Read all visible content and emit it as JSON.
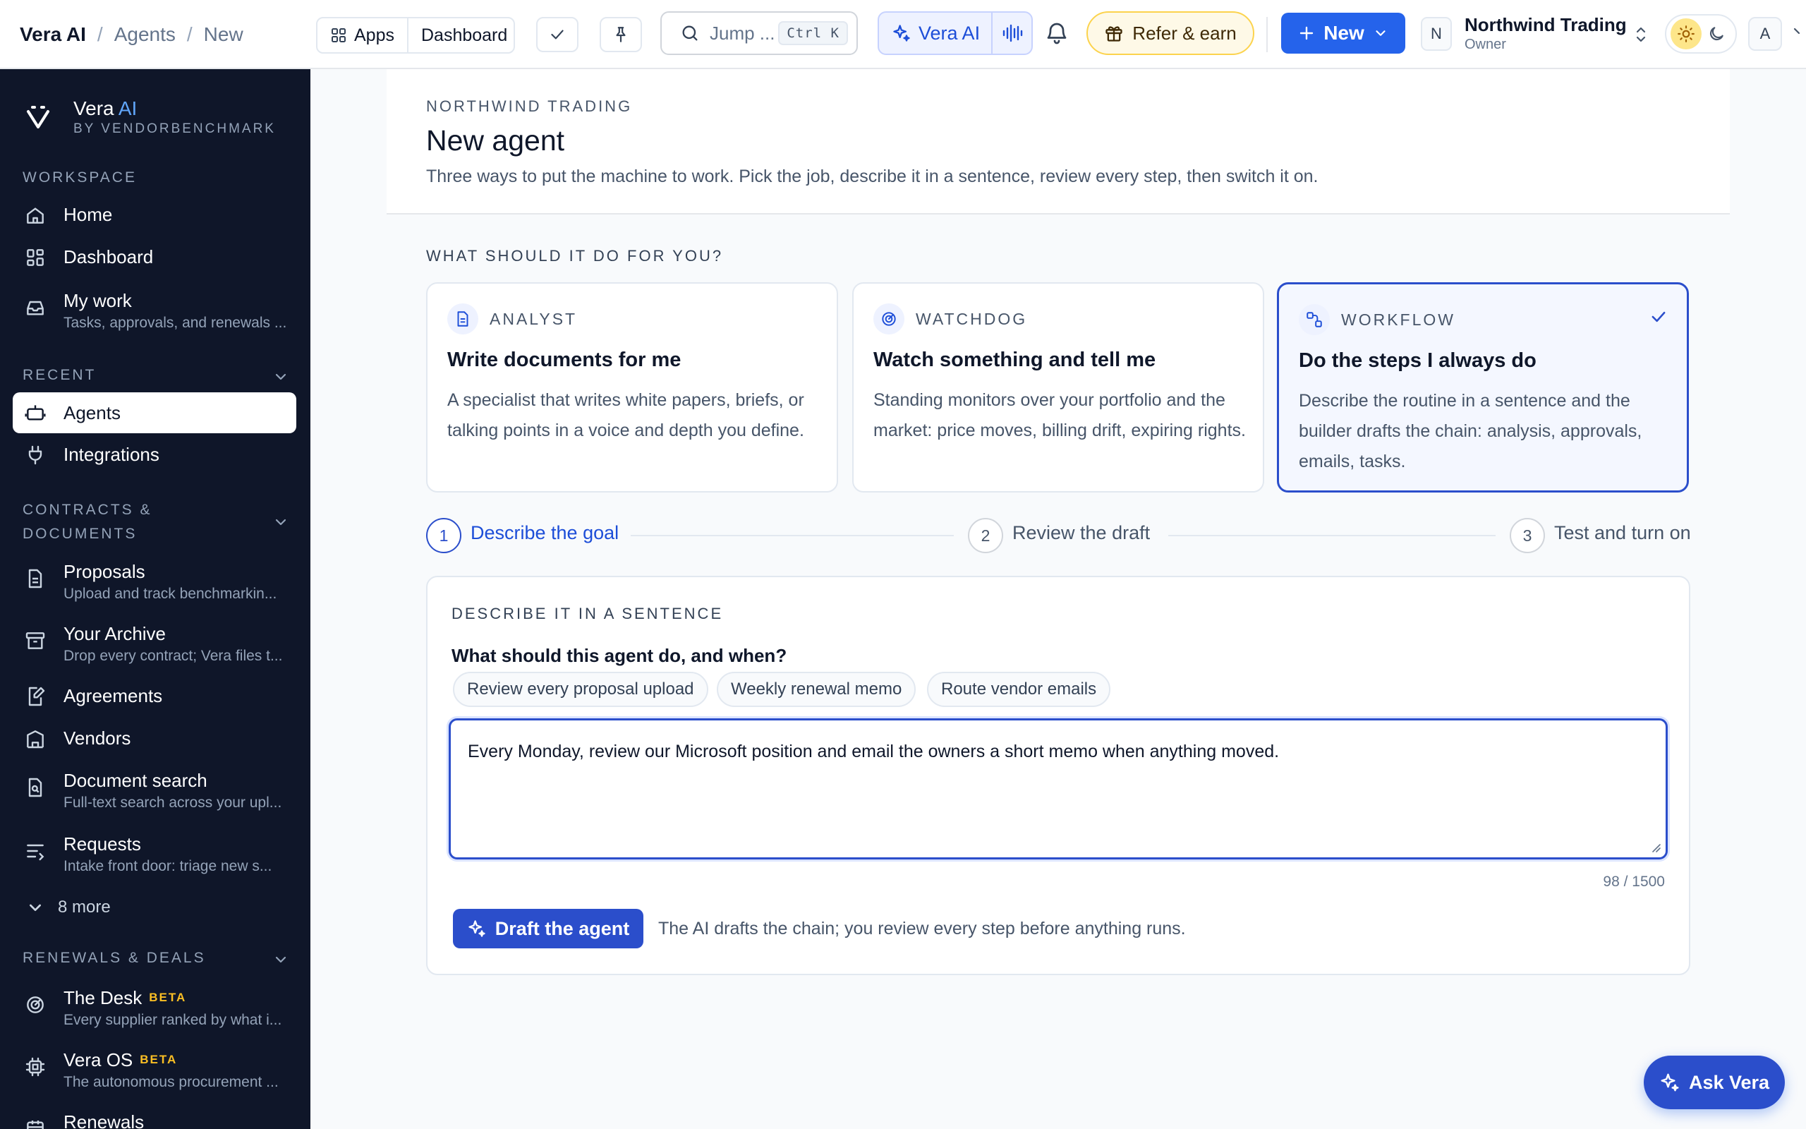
{
  "breadcrumb": [
    "Vera AI",
    "Agents",
    "New"
  ],
  "toolbar": {
    "apps_label": "Apps",
    "dashboard_label": "Dashboard",
    "search_placeholder": "Jump ...",
    "search_shortcut": "Ctrl K",
    "vera_label": "Vera AI",
    "refer_label": "Refer & earn",
    "new_label": "New",
    "org_initial": "N",
    "org_name": "Northwind Trading",
    "org_role": "Owner",
    "user_initial": "A"
  },
  "brand": {
    "name": "Vera",
    "accent": "AI",
    "sub": "BY VENDORBENCHMARK"
  },
  "sidebar": {
    "workspace": {
      "label": "WORKSPACE",
      "items": [
        {
          "label": "Home",
          "icon": "home-icon"
        },
        {
          "label": "Dashboard",
          "icon": "grid-icon"
        },
        {
          "label": "My work",
          "sub": "Tasks, approvals, and renewals ...",
          "icon": "inbox-icon"
        }
      ]
    },
    "recent": {
      "label": "RECENT",
      "items": [
        {
          "label": "Agents",
          "icon": "robot-icon",
          "active": true
        },
        {
          "label": "Integrations",
          "icon": "plug-icon"
        }
      ]
    },
    "contracts": {
      "label_line1": "CONTRACTS &",
      "label_line2": "DOCUMENTS",
      "items": [
        {
          "label": "Proposals",
          "sub": "Upload and track benchmarkin...",
          "icon": "document-icon"
        },
        {
          "label": "Your Archive",
          "sub": "Drop every contract; Vera files t...",
          "icon": "archive-icon"
        },
        {
          "label": "Agreements",
          "icon": "pen-document-icon"
        },
        {
          "label": "Vendors",
          "icon": "building-icon"
        },
        {
          "label": "Document search",
          "sub": "Full-text search across your upl...",
          "icon": "doc-search-icon"
        },
        {
          "label": "Requests",
          "sub": "Intake front door: triage new s...",
          "icon": "list-arrow-icon"
        }
      ],
      "more_label": "8 more"
    },
    "renewals": {
      "label": "RENEWALS & DEALS",
      "items": [
        {
          "label": "The Desk",
          "badge": "BETA",
          "sub": "Every supplier ranked by what i...",
          "icon": "radar-icon"
        },
        {
          "label": "Vera OS",
          "badge": "BETA",
          "sub": "The autonomous procurement ...",
          "icon": "chip-icon"
        },
        {
          "label": "Renewals",
          "icon": "calendar-icon"
        }
      ]
    }
  },
  "header": {
    "eyebrow": "NORTHWIND TRADING",
    "title": "New agent",
    "description": "Three ways to put the machine to work. Pick the job, describe it in a sentence, review every step, then switch it on."
  },
  "agent_types": {
    "question": "WHAT SHOULD IT DO FOR YOU?",
    "options": [
      {
        "kind": "ANALYST",
        "title": "Write documents for me",
        "desc": "A specialist that writes white papers, briefs, or talking points in a voice and depth you define.",
        "selected": false
      },
      {
        "kind": "WATCHDOG",
        "title": "Watch something and tell me",
        "desc": "Standing monitors over your portfolio and the market: price moves, billing drift, expiring rights.",
        "selected": false
      },
      {
        "kind": "WORKFLOW",
        "title": "Do the steps I always do",
        "desc": "Describe the routine in a sentence and the builder drafts the chain: analysis, approvals, emails, tasks.",
        "selected": true
      }
    ]
  },
  "steps": [
    {
      "num": "1",
      "label": "Describe the goal",
      "active": true
    },
    {
      "num": "2",
      "label": "Review the draft",
      "active": false
    },
    {
      "num": "3",
      "label": "Test and turn on",
      "active": false
    }
  ],
  "describe": {
    "label": "DESCRIBE IT IN A SENTENCE",
    "question": "What should this agent do, and when?",
    "chips": [
      "Review every proposal upload",
      "Weekly renewal memo",
      "Route vendor emails"
    ],
    "value": "Every Monday, review our Microsoft position and email the owners a short memo when anything moved.",
    "counter": "98 / 1500",
    "draft_label": "Draft the agent",
    "draft_note": "The AI drafts the chain; you review every step before anything runs."
  },
  "ask_vera_label": "Ask Vera",
  "colors": {
    "accent": "#2b4ecb",
    "sidebar_bg": "#0f1629",
    "beta": "#fbbf24",
    "refer_bg": "#fef9e7"
  }
}
